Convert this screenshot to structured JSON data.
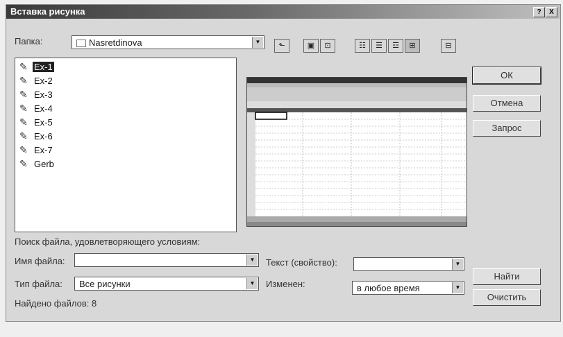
{
  "dialog": {
    "title": "Вставка рисунка",
    "help_label": "?",
    "close_label": "X"
  },
  "folder": {
    "label": "Папка:",
    "value": "Nasretdinova"
  },
  "toolbar": {
    "icons": [
      "folder-up-icon",
      "desktop-icon",
      "favorites-icon",
      "list-view-icon",
      "details-view-icon",
      "properties-view-icon",
      "preview-view-icon",
      "commands-icon"
    ]
  },
  "files": [
    {
      "name": "Ex-1",
      "selected": true
    },
    {
      "name": "Ex-2",
      "selected": false
    },
    {
      "name": "Ex-3",
      "selected": false
    },
    {
      "name": "Ex-4",
      "selected": false
    },
    {
      "name": "Ex-5",
      "selected": false
    },
    {
      "name": "Ex-6",
      "selected": false
    },
    {
      "name": "Ex-7",
      "selected": false
    },
    {
      "name": "Gerb",
      "selected": false
    }
  ],
  "buttons": {
    "ok": "ОК",
    "cancel": "Отмена",
    "query": "Запрос",
    "find": "Найти",
    "clear": "Очистить"
  },
  "search": {
    "heading": "Поиск файла, удовлетворяющего условиям:",
    "filename_label": "Имя файла:",
    "filename_value": "",
    "filetype_label": "Тип файла:",
    "filetype_value": "Все рисунки",
    "text_label": "Текст (свойство):",
    "text_value": "",
    "modified_label": "Изменен:",
    "modified_value": "в любое время",
    "found_text": "Найдено файлов: 8"
  }
}
